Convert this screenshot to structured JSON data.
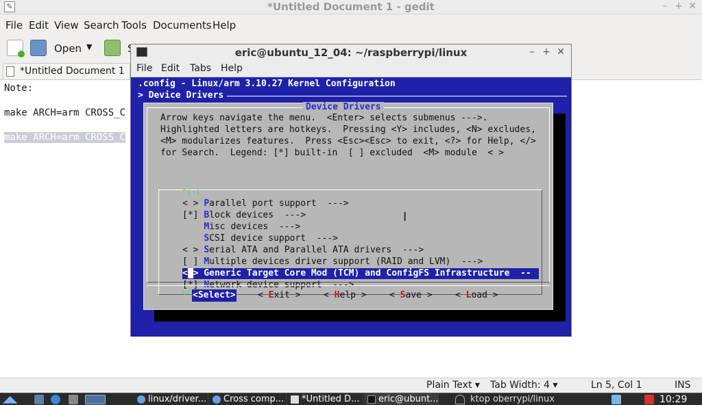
{
  "gedit": {
    "title": "*Untitled Document 1 - gedit",
    "menu": [
      "File",
      "Edit",
      "View",
      "Search",
      "Tools",
      "Documents",
      "Help"
    ],
    "toolbar": {
      "open_label": "Open",
      "partial_label": "S"
    },
    "tab_label": "*Untitled Document 1",
    "editor_lines": [
      "Note:",
      "make ARCH=arm CROSS_C",
      "make ARCH=arm CROSS_C"
    ],
    "status": {
      "language": "Plain Text ▾",
      "tab_width": "Tab Width: 4 ▾",
      "position": "Ln 5, Col 1",
      "mode": "INS"
    }
  },
  "terminal": {
    "title": "eric@ubuntu_12_04: ~/raspberrypi/linux",
    "menu": [
      "File",
      "Edit",
      "Tabs",
      "Help"
    ]
  },
  "menuconfig": {
    "header": ".config - Linux/arm 3.10.27 Kernel Configuration",
    "breadcrumb": "> Device Drivers",
    "dialog_title": "Device Drivers",
    "help_lines": [
      "Arrow keys navigate the menu.  <Enter> selects submenus --->.",
      "Highlighted letters are hotkeys.  Pressing <Y> includes, <N> excludes,",
      "<M> modularizes features.  Press <Esc><Esc> to exit, <?> for Help, </>",
      "for Search.  Legend: [*] built-in  [ ] excluded  <M> module  < >"
    ],
    "scroll_up": "^(-)",
    "scroll_down": "v(+)",
    "items": [
      {
        "prefix": "< > ",
        "hotkey": "P",
        "rest": "arallel port support  --->",
        "selected": false
      },
      {
        "prefix": "[*] ",
        "hotkey": "B",
        "rest": "lock devices  --->",
        "selected": false
      },
      {
        "prefix": "    ",
        "hotkey": "M",
        "rest": "isc devices  --->",
        "selected": false
      },
      {
        "prefix": "    ",
        "hotkey": "S",
        "rest": "CSI device support  --->",
        "selected": false
      },
      {
        "prefix": "< > ",
        "hotkey": "S",
        "rest": "erial ATA and Parallel ATA drivers  --->",
        "selected": false
      },
      {
        "prefix": "[ ] ",
        "hotkey": "M",
        "rest": "ultiple devices driver support (RAID and LVM)  --->",
        "selected": false
      },
      {
        "prefix": "< > ",
        "hotkey": "",
        "rest": "Generic Target Core Mod (TCM) and ConfigFS Infrastructure  --",
        "selected": true
      },
      {
        "prefix": "[*] ",
        "hotkey": "N",
        "rest": "etwork device support  --->",
        "selected": false
      }
    ],
    "buttons": [
      {
        "pre": "<",
        "hotkey": "S",
        "rest": "elect>",
        "active": true
      },
      {
        "pre": "< ",
        "hotkey": "E",
        "rest": "xit >",
        "active": false
      },
      {
        "pre": "< ",
        "hotkey": "H",
        "rest": "elp >",
        "active": false
      },
      {
        "pre": "< ",
        "hotkey": "S",
        "rest": "ave >",
        "active": false
      },
      {
        "pre": "< ",
        "hotkey": "L",
        "rest": "oad >",
        "active": false
      }
    ]
  },
  "taskbar": {
    "tasks": [
      "linux/driver...",
      "Cross comp...",
      "*Untitled D...",
      "eric@ubunt..."
    ],
    "desktop_name": "ktop  oberrypi/linux",
    "time": "10:29"
  },
  "colors": {
    "terminal_blue": "#1f22a8",
    "dialog_grey": "#b7b7b7",
    "hotkey_blue": "#2a2bd0",
    "button_hotkey_red": "#b21d1d"
  }
}
